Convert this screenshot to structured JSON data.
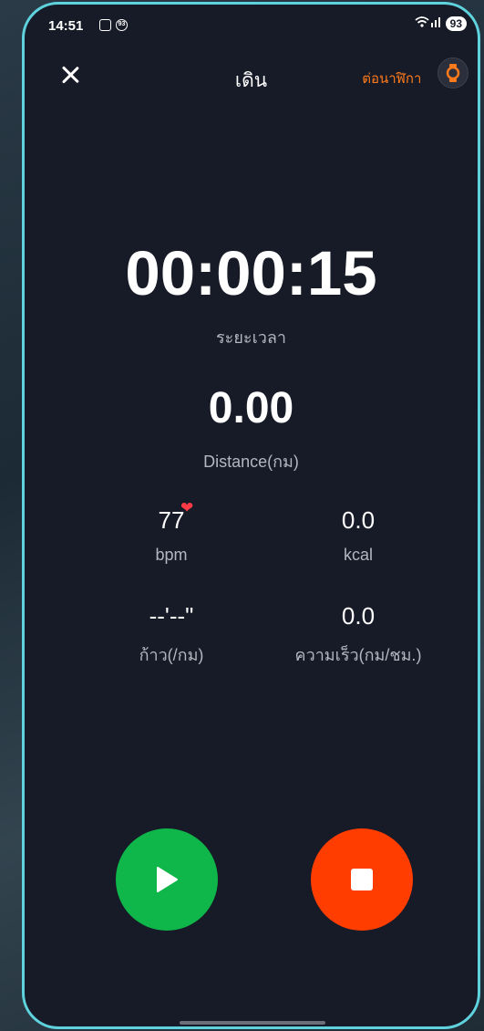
{
  "status_bar": {
    "time": "14:51",
    "notif_badge": "93",
    "battery": "93"
  },
  "header": {
    "title": "เดิน",
    "connect_label": "เชื่อมต่อนาฬิกา"
  },
  "timer": {
    "value": "00:00:15",
    "label": "ระยะเวลา"
  },
  "distance": {
    "value": "0.00",
    "label": "Distance(กม)"
  },
  "stats": {
    "heart_rate": {
      "value": "77",
      "label": "bpm"
    },
    "calories": {
      "value": "0.0",
      "label": "kcal"
    },
    "pace": {
      "value": "--'--\"",
      "label": "ก้าว(/กม)"
    },
    "speed": {
      "value": "0.0",
      "label": "ความเร็ว(กม/ชม.)"
    }
  },
  "colors": {
    "accent_border": "#5fd3dd",
    "play": "#0fb74a",
    "stop": "#ff3d00",
    "connect": "#ff7a1a",
    "heart": "#ff3b46"
  }
}
